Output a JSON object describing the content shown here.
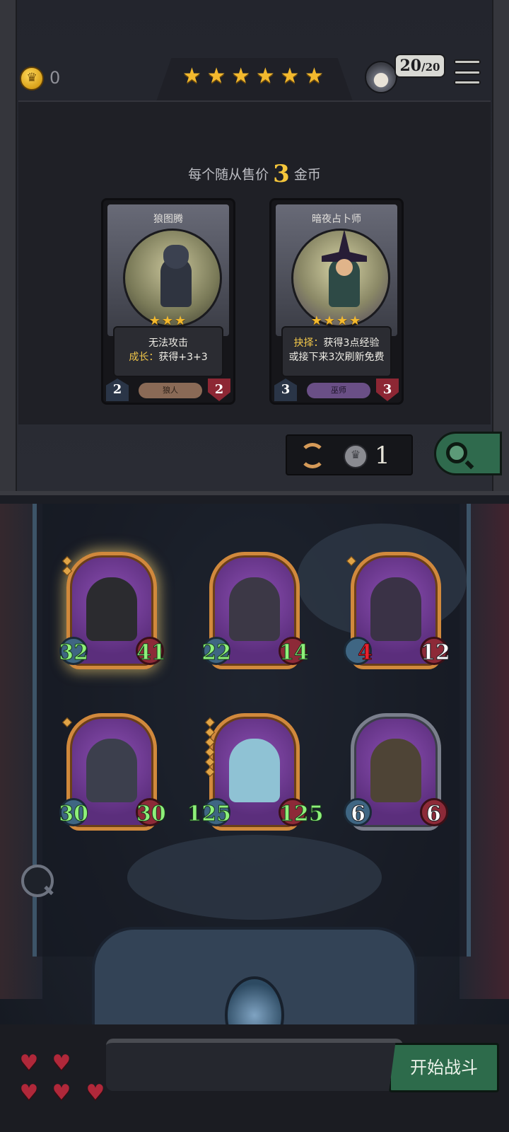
{
  "status_bar": {
    "coins": "0",
    "tier_stars": 6,
    "level": "20",
    "level_max": "20"
  },
  "shop": {
    "price_prefix": "每个随从售价",
    "price_value": "3",
    "price_suffix": "金币",
    "cards": [
      {
        "name": "狼图腾",
        "stars": "★★★",
        "desc_line1": "无法攻击",
        "desc_kw": "成长：",
        "desc_line2": "获得+3+3",
        "attack": "2",
        "health": "2",
        "tribe": "狼人"
      },
      {
        "name": "暗夜占卜师",
        "stars": "★★★★",
        "desc_kw": "抉择：",
        "desc_line1": "获得3点经验",
        "desc_line2": "或接下来3次刷新免费",
        "attack": "3",
        "health": "3",
        "tribe": "巫师"
      }
    ],
    "refresh_cost": "1"
  },
  "board": {
    "units": [
      {
        "attack": "32",
        "health": "41",
        "atk_style": "green",
        "hp_style": "green"
      },
      {
        "attack": "22",
        "health": "14",
        "atk_style": "green",
        "hp_style": "green"
      },
      {
        "attack": "4",
        "health": "12",
        "atk_style": "strike",
        "hp_style": "white"
      },
      {
        "attack": "30",
        "health": "30",
        "atk_style": "green",
        "hp_style": "green"
      },
      {
        "attack": "125",
        "health": "125",
        "atk_style": "green",
        "hp_style": "green"
      },
      {
        "attack": "6",
        "health": "6",
        "atk_style": "white",
        "hp_style": "white"
      }
    ]
  },
  "lives": {
    "total": 5,
    "remaining": 5
  },
  "start_button": "开始战斗",
  "colors": {
    "gold": "#f5c63b",
    "buff_green": "#8ef07a",
    "accent_orange": "#d1893c",
    "button_green": "#2d6b4b"
  }
}
